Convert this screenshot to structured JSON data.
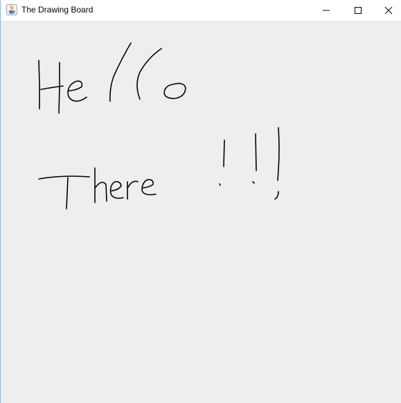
{
  "window": {
    "title": "The Drawing Board",
    "app_icon": "java-cup-icon"
  },
  "controls": {
    "minimize": "minimize-icon",
    "maximize": "maximize-icon",
    "close": "close-icon"
  },
  "canvas": {
    "background": "#eeeeee",
    "stroke_color": "#000000"
  }
}
